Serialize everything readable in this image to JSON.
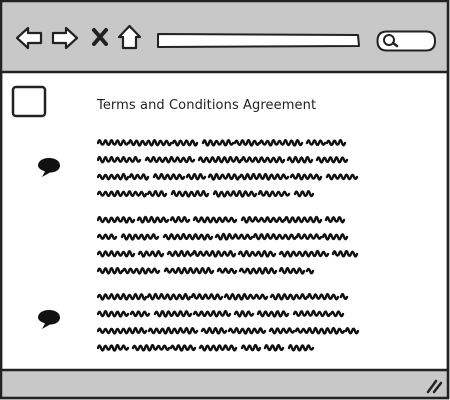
{
  "window": {
    "chrome_color": "#c8c8c8",
    "stroke_color": "#222222",
    "background": "#ffffff"
  },
  "toolbar": {
    "back_icon": "arrow-left-icon",
    "forward_icon": "arrow-right-icon",
    "stop_icon": "close-icon",
    "home_icon": "home-icon",
    "address_value": "",
    "search_value": "",
    "search_icon": "magnifier-icon"
  },
  "content": {
    "agree_checkbox_checked": false,
    "title": "Terms and Conditions Agreement",
    "paragraphs": [
      {
        "line_widths": [
          245,
          245,
          260,
          215
        ]
      },
      {
        "line_widths": [
          245,
          245,
          260,
          215
        ]
      },
      {
        "line_widths": [
          245,
          245,
          260,
          215
        ]
      }
    ],
    "comment_icons": [
      "comment-icon",
      "comment-icon"
    ]
  },
  "statusbar": {
    "resize_icon": "resize-grip-icon"
  }
}
